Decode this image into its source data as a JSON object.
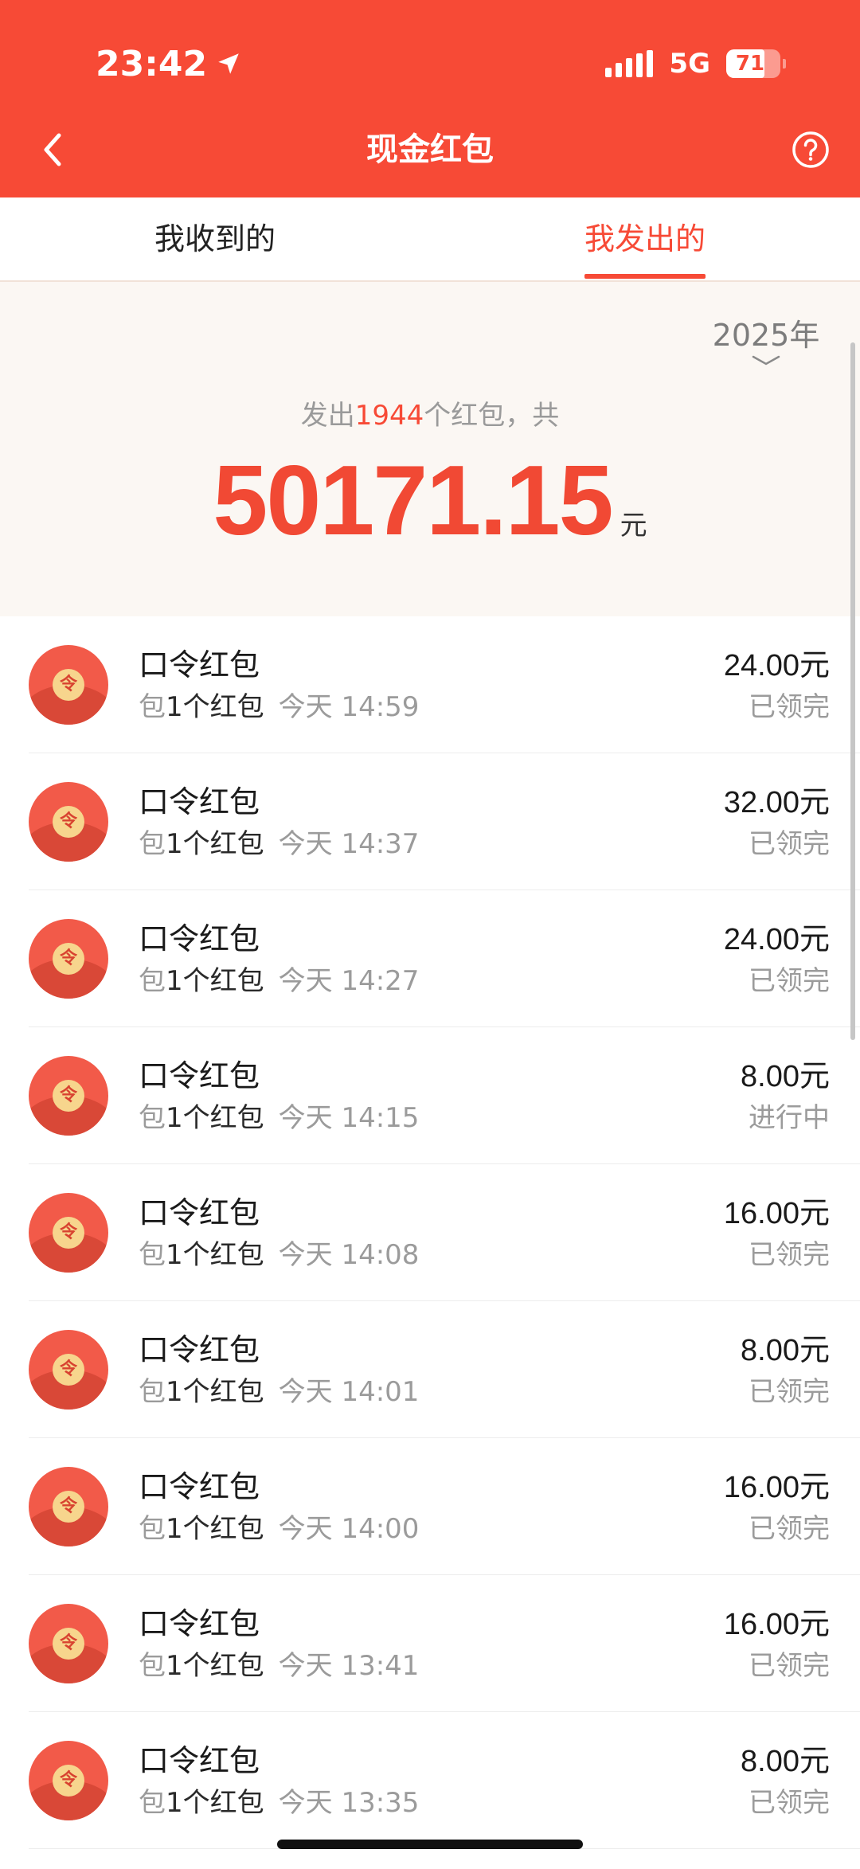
{
  "status_bar": {
    "time": "23:42",
    "network": "5G",
    "battery": "71",
    "battery_level_percent": 71
  },
  "nav": {
    "title": "现金红包",
    "back_icon": "chevron-left-icon",
    "help_icon": "question-circle-icon"
  },
  "tabs": [
    {
      "label": "我收到的",
      "active": false
    },
    {
      "label": "我发出的",
      "active": true
    }
  ],
  "summary": {
    "year": "2025年",
    "prefix": "发出",
    "count": "1944",
    "suffix": "个红包，共",
    "amount": "50171.15",
    "unit": "元"
  },
  "records": [
    {
      "title": "口令红包",
      "pack": "包",
      "qty": "1个红包",
      "time": "今天 14:59",
      "amount": "24.00元",
      "status": "已领完"
    },
    {
      "title": "口令红包",
      "pack": "包",
      "qty": "1个红包",
      "time": "今天 14:37",
      "amount": "32.00元",
      "status": "已领完"
    },
    {
      "title": "口令红包",
      "pack": "包",
      "qty": "1个红包",
      "time": "今天 14:27",
      "amount": "24.00元",
      "status": "已领完"
    },
    {
      "title": "口令红包",
      "pack": "包",
      "qty": "1个红包",
      "time": "今天 14:15",
      "amount": "8.00元",
      "status": "进行中"
    },
    {
      "title": "口令红包",
      "pack": "包",
      "qty": "1个红包",
      "time": "今天 14:08",
      "amount": "16.00元",
      "status": "已领完"
    },
    {
      "title": "口令红包",
      "pack": "包",
      "qty": "1个红包",
      "time": "今天 14:01",
      "amount": "8.00元",
      "status": "已领完"
    },
    {
      "title": "口令红包",
      "pack": "包",
      "qty": "1个红包",
      "time": "今天 14:00",
      "amount": "16.00元",
      "status": "已领完"
    },
    {
      "title": "口令红包",
      "pack": "包",
      "qty": "1个红包",
      "time": "今天 13:41",
      "amount": "16.00元",
      "status": "已领完"
    },
    {
      "title": "口令红包",
      "pack": "包",
      "qty": "1个红包",
      "time": "今天 13:35",
      "amount": "8.00元",
      "status": "已领完"
    }
  ],
  "avatar_seal_char": "令",
  "colors": {
    "brand_red": "#f74a36",
    "amount_red": "#f14934",
    "summary_bg": "#fbf7f3",
    "seal_gold": "#f7d58d"
  }
}
